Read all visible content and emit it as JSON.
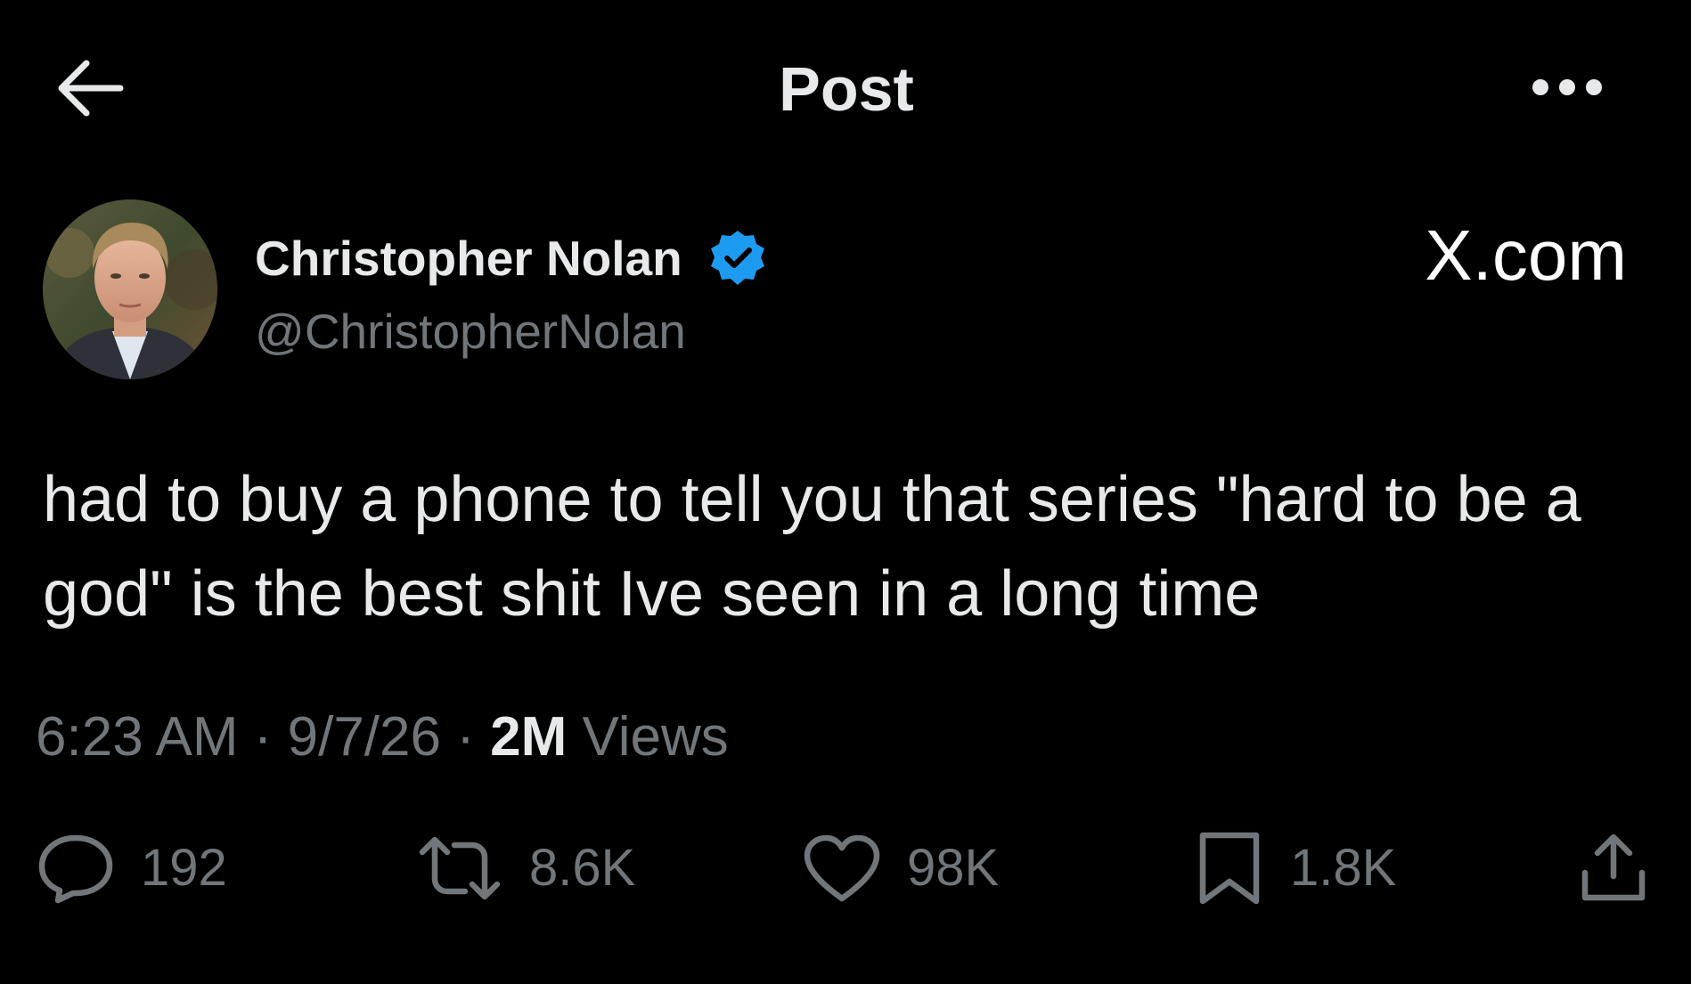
{
  "header": {
    "title": "Post",
    "back_icon": "arrow-left-icon",
    "more_icon": "more-horizontal-icon"
  },
  "author": {
    "name": "Christopher Nolan",
    "handle": "@ChristopherNolan",
    "verified": true,
    "verified_color": "#1d9bf0"
  },
  "watermark": "X.com",
  "post": {
    "text": "had to buy a phone to tell you that series \"hard to be a god\" is the best shit Ive seen in a long time"
  },
  "meta": {
    "time": "6:23 AM",
    "separator": "·",
    "date": "9/7/26",
    "views_count": "2M",
    "views_label": "Views"
  },
  "actions": {
    "replies": "192",
    "reposts": "8.6K",
    "likes": "98K",
    "bookmarks": "1.8K"
  },
  "colors": {
    "background": "#000000",
    "primary_text": "#e7e9ea",
    "secondary_text": "#71767b"
  }
}
